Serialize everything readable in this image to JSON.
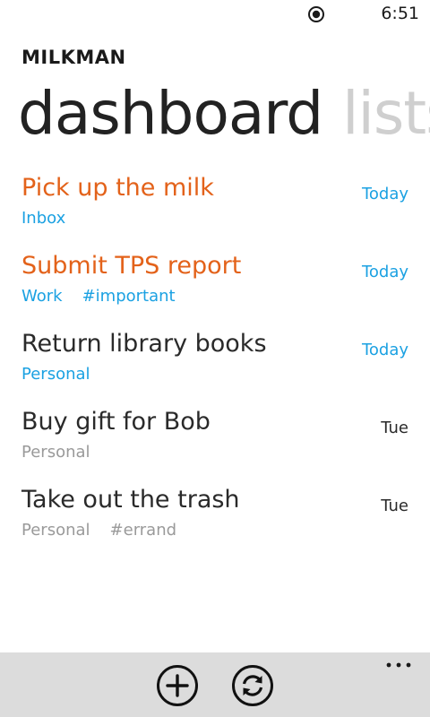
{
  "status_bar": {
    "time": "6:51",
    "icon": "location-target-icon"
  },
  "app": {
    "title": "MILKMAN"
  },
  "pivot": {
    "active": "dashboard",
    "next": "lists"
  },
  "tasks": [
    {
      "title": "Pick up the milk",
      "list": "Inbox",
      "tag": "",
      "due": "Today",
      "title_color": "#e3621a",
      "meta_color": "#1ba1e2",
      "due_color": "#1ba1e2"
    },
    {
      "title": "Submit TPS report",
      "list": "Work",
      "tag": "#important",
      "due": "Today",
      "title_color": "#e3621a",
      "meta_color": "#1ba1e2",
      "due_color": "#1ba1e2"
    },
    {
      "title": "Return library books",
      "list": "Personal",
      "tag": "",
      "due": "Today",
      "title_color": "#2a2a2a",
      "meta_color": "#1ba1e2",
      "due_color": "#1ba1e2"
    },
    {
      "title": "Buy gift for Bob",
      "list": "Personal",
      "tag": "",
      "due": "Tue",
      "title_color": "#2a2a2a",
      "meta_color": "#9a9a9a",
      "due_color": "#2a2a2a"
    },
    {
      "title": "Take out the trash",
      "list": "Personal",
      "tag": "#errand",
      "due": "Tue",
      "title_color": "#2a2a2a",
      "meta_color": "#9a9a9a",
      "due_color": "#2a2a2a"
    }
  ],
  "app_bar": {
    "buttons": [
      {
        "name": "add-button",
        "icon": "plus-circle-icon"
      },
      {
        "name": "sync-button",
        "icon": "sync-circle-icon"
      }
    ],
    "more_icon": "ellipsis-icon"
  }
}
